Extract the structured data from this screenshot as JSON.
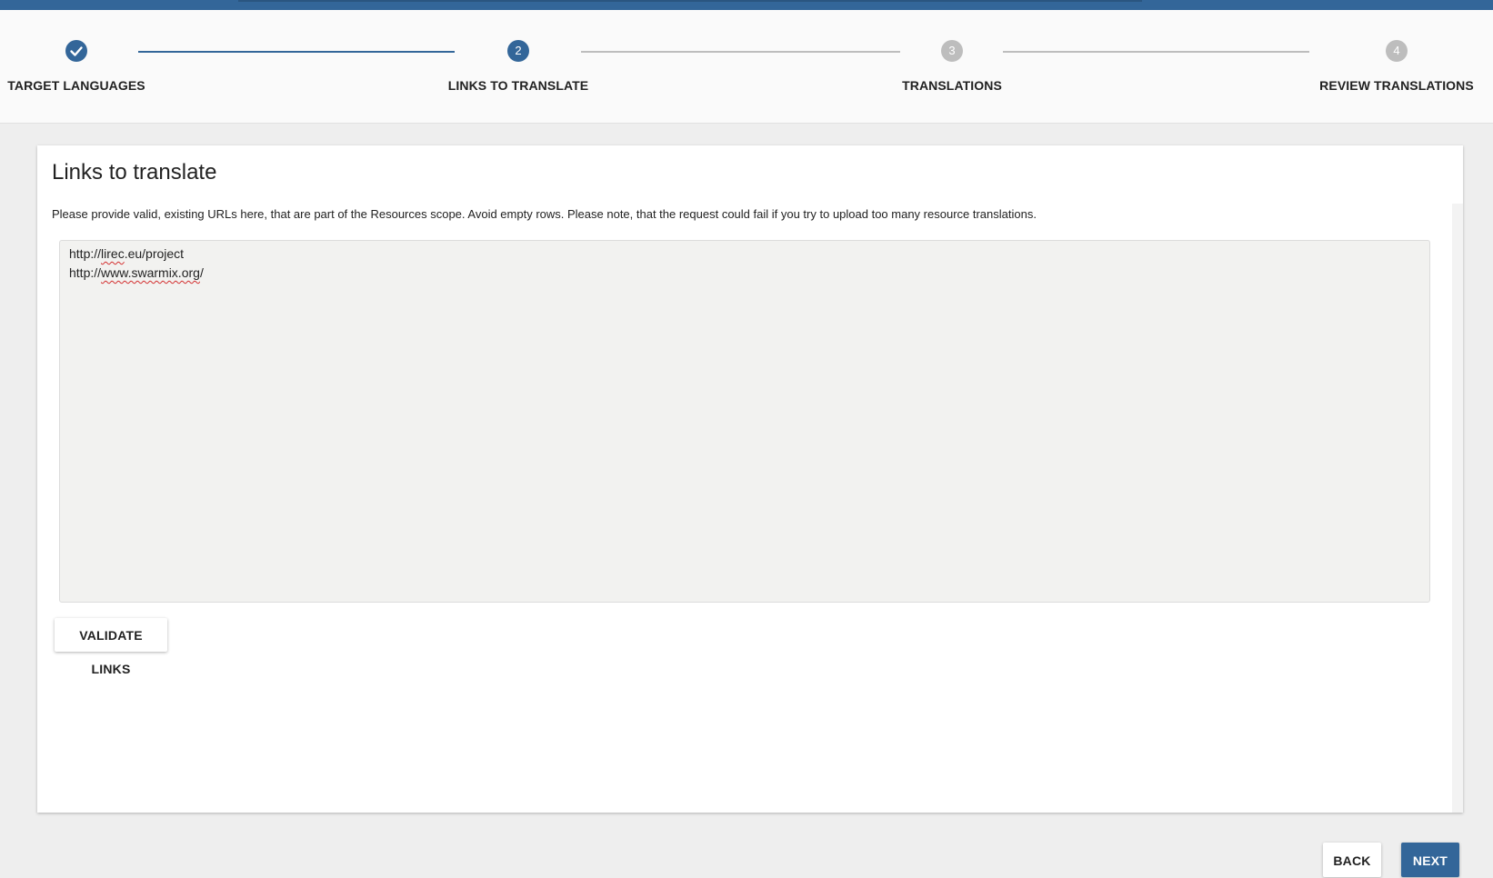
{
  "stepper": {
    "steps": [
      {
        "number": "",
        "label": "TARGET LANGUAGES",
        "state": "completed",
        "icon": "check-icon"
      },
      {
        "number": "2",
        "label": "LINKS TO TRANSLATE",
        "state": "active"
      },
      {
        "number": "3",
        "label": "TRANSLATIONS",
        "state": "inactive"
      },
      {
        "number": "4",
        "label": "REVIEW TRANSLATIONS",
        "state": "inactive"
      }
    ]
  },
  "card": {
    "title": "Links to translate",
    "description": "Please provide valid, existing URLs here, that are part of the Resources scope. Avoid empty rows. Please note, that the request could fail if you try to upload too many resource translations.",
    "links": {
      "line1_prefix": "http://",
      "line1_word": "lirec",
      "line1_rest": ".eu/project",
      "line2_prefix": "http://",
      "line2_word": "www.swarmix.org",
      "line2_rest": "/"
    },
    "validate_label": "VALIDATE LINKS"
  },
  "footer": {
    "back_label": "BACK",
    "next_label": "NEXT"
  },
  "colors": {
    "primary": "#336699",
    "inactive": "#bdbdbd",
    "spellcheck": "#d32f2f"
  }
}
